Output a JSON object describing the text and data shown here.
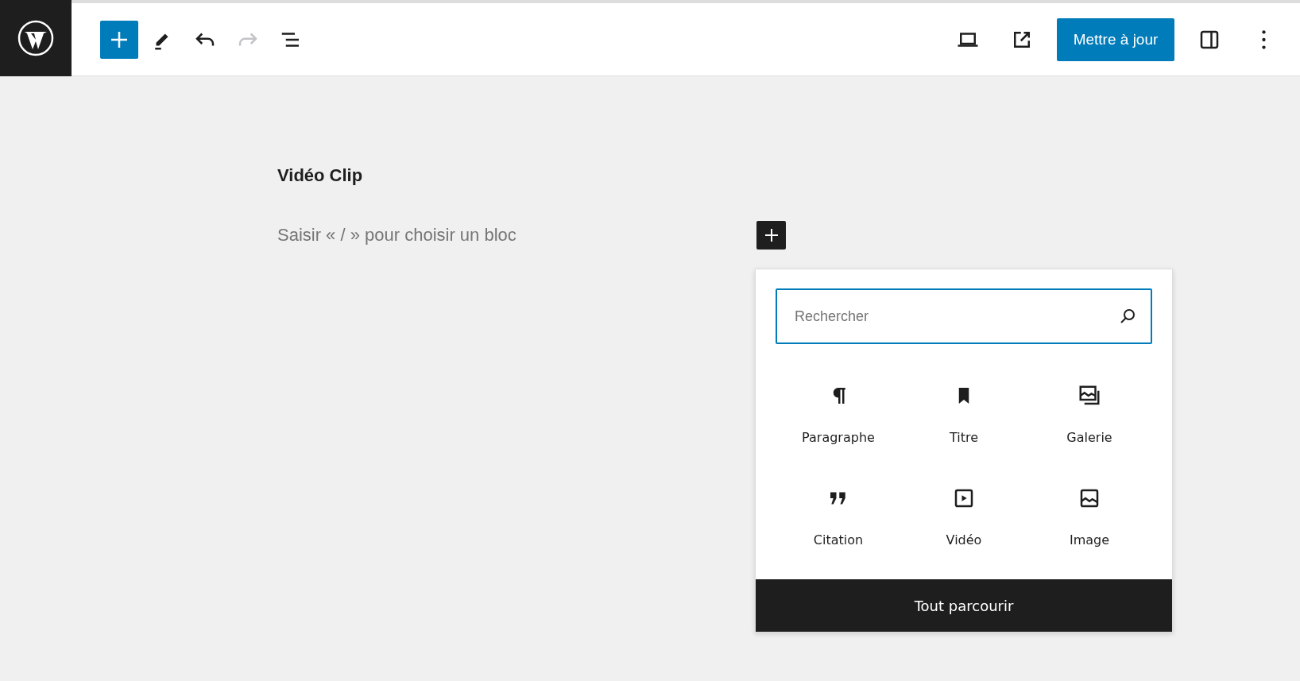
{
  "toolbar": {
    "left": [
      {
        "kind": "add",
        "on": true
      },
      {
        "kind": "pencil",
        "on": false
      },
      {
        "kind": "undo",
        "disabled": false
      },
      {
        "kind": "redo",
        "disabled": true
      },
      {
        "kind": "outline",
        "on": false
      }
    ],
    "right_icons": [
      {
        "kind": "laptop"
      },
      {
        "kind": "external"
      }
    ],
    "update_button": "Mettre à jour",
    "end_icons": [
      {
        "kind": "sidebar"
      },
      {
        "kind": "more"
      }
    ]
  },
  "editor": {
    "title": "Vidéo Clip",
    "placeholder": "Saisir « / » pour choisir un bloc"
  },
  "inserter": {
    "search": {
      "placeholder": "Rechercher"
    },
    "blocks": [
      {
        "kind": "paragraph",
        "label": "Paragraphe"
      },
      {
        "kind": "heading",
        "label": "Titre"
      },
      {
        "kind": "gallery",
        "label": "Galerie"
      },
      {
        "kind": "quote",
        "label": "Citation"
      },
      {
        "kind": "video",
        "label": "Vidéo"
      },
      {
        "kind": "image",
        "label": "Image"
      }
    ],
    "browse_all": "Tout parcourir"
  }
}
